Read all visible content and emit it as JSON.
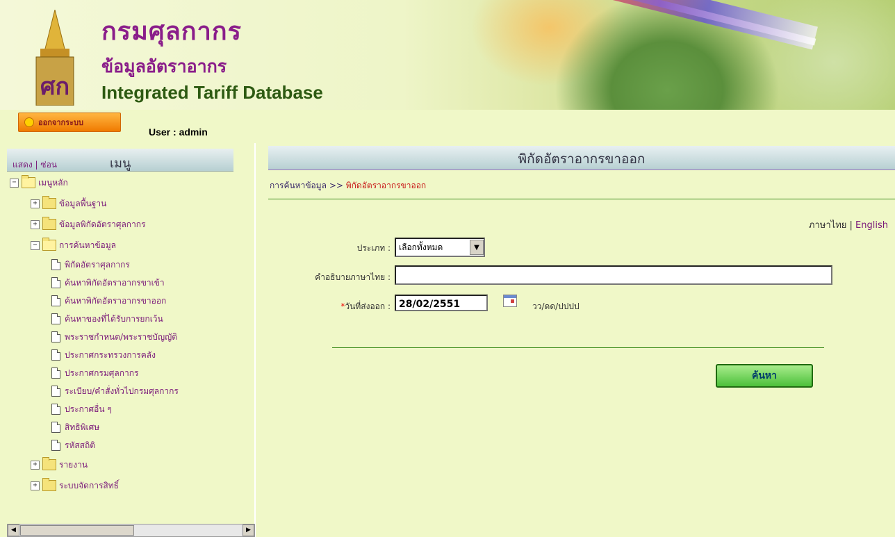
{
  "header": {
    "title_th": "กรมศุลกากร",
    "subtitle_th": "ข้อมูลอัตราอากร",
    "subtitle_en": "Integrated Tariff Database"
  },
  "userbar": {
    "logout_label": "ออกจากระบบ",
    "user_label": "User : admin"
  },
  "menu": {
    "show_label": "แสดง",
    "separator": "|",
    "hide_label": "ซ่อน",
    "title": "เมนู",
    "root_label": "เมนูหลัก",
    "items": [
      {
        "label": "ข้อมูลพื้นฐาน",
        "type": "folder",
        "expanded": false
      },
      {
        "label": "ข้อมูลพิกัดอัตราศุลกากร",
        "type": "folder",
        "expanded": false
      },
      {
        "label": "การค้นหาข้อมูล",
        "type": "folder",
        "expanded": true
      },
      {
        "label": "พิกัดอัตราศุลกากร",
        "type": "doc"
      },
      {
        "label": "ค้นหาพิกัดอัตราอากรขาเข้า",
        "type": "doc"
      },
      {
        "label": "ค้นหาพิกัดอัตราอากรขาออก",
        "type": "doc"
      },
      {
        "label": "ค้นหาของที่ได้รับการยกเว้น",
        "type": "doc"
      },
      {
        "label": "พระราชกำหนด/พระราชบัญญัติ",
        "type": "doc"
      },
      {
        "label": "ประกาศกระทรวงการคลัง",
        "type": "doc"
      },
      {
        "label": "ประกาศกรมศุลกากร",
        "type": "doc"
      },
      {
        "label": "ระเบียบ/คำสั่งทั่วไปกรมศุลกากร",
        "type": "doc"
      },
      {
        "label": "ประกาศอื่น ๆ",
        "type": "doc"
      },
      {
        "label": "สิทธิพิเศษ",
        "type": "doc"
      },
      {
        "label": "รหัสสถิติ",
        "type": "doc"
      },
      {
        "label": "รายงาน",
        "type": "folder",
        "expanded": false
      },
      {
        "label": "ระบบจัดการสิทธิ์",
        "type": "folder",
        "expanded": false
      }
    ]
  },
  "main": {
    "title": "พิกัดอัตราอากรขาออก",
    "breadcrumb_parent": "การค้นหาข้อมูล >> ",
    "breadcrumb_current": "พิกัดอัตราอากรขาออก",
    "lang_thai": "ภาษาไทย",
    "lang_sep": " | ",
    "lang_english": "English",
    "form": {
      "type_label": "ประเภท :",
      "type_value": "เลือกทั้งหมด",
      "desc_label": "คำอธิบายภาษาไทย :",
      "desc_value": "",
      "date_required_mark": "*",
      "date_label": "วันที่ส่งออก :",
      "date_value": "28/02/2551",
      "date_hint": "วว/ดด/ปปปป",
      "search_label": "ค้นหา"
    }
  }
}
